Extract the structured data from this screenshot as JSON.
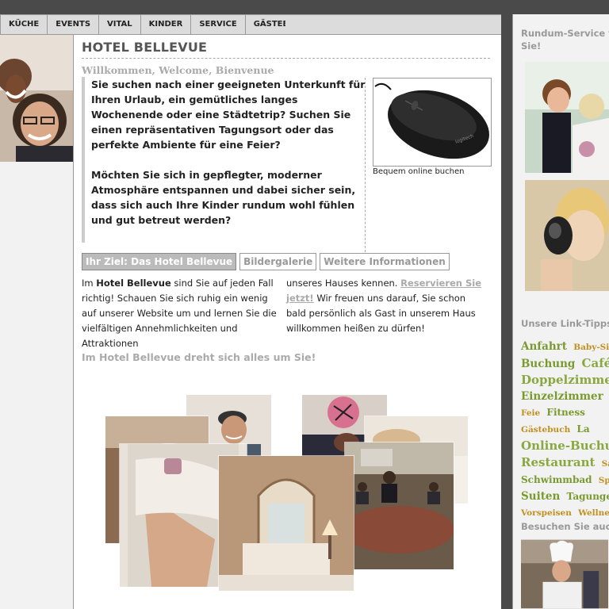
{
  "nav": {
    "items": [
      "KÜCHE",
      "EVENTS",
      "VITAL",
      "KINDER",
      "SERVICE",
      "GÄSTEBUCH"
    ]
  },
  "page": {
    "title": "HOTEL BELLEVUE",
    "subtitle": "Willkommen, Welcome, Bienvenue",
    "intro_p1": "Sie suchen nach einer geeigneten Unterkunft für Ihren Urlaub, ein gemütliches langes Wochenende oder eine Städtetrip? Suchen Sie einen repräsentativen Tagungsort oder das perfekte Ambiente für eine Feier?",
    "intro_p2": "Möchten Sie sich in gepflegter, moderner Atmosphäre entspannen und dabei sicher sein, dass sich auch Ihre Kinder rundum wohl fühlen und gut betreut werden?",
    "mouse_caption": "Bequem online buchen"
  },
  "tabs": [
    "Ihr Ziel: Das Hotel Bellevue",
    "Bildergalerie",
    "Weitere Informationen"
  ],
  "body": {
    "left_pre": "Im ",
    "left_bold": "Hotel Bellevue",
    "left_post": " sind Sie auf jeden Fall richtig! Schauen Sie sich ruhig ein wenig auf unserer Website um und lernen Sie die vielfältigen Annehmlichkeiten und Attraktionen",
    "right_pre": "unseres Hauses kennen. ",
    "right_link": "Reservieren Sie jetzt!",
    "right_post": " Wir freuen uns darauf, Sie schon bald persönlich als Gast in unserem Haus willkommen heißen zu dürfen!",
    "tagline": "Im Hotel Bellevue dreht sich alles um Sie!"
  },
  "sidebar": {
    "heading1": "Rundum-Service f",
    "heading1_line2": "Sie!",
    "heading2": "Unsere Link-Tipps",
    "heading3": "Besuchen Sie auc",
    "tags": [
      {
        "label": "Anfahrt",
        "size": "t-l"
      },
      {
        "label": "Baby-Sitte",
        "size": "t-s"
      },
      {
        "label": "Buchung",
        "size": "t-l"
      },
      {
        "label": "Café",
        "size": "t-xl"
      },
      {
        "label": "Doppelzimmer",
        "size": "t-xl"
      },
      {
        "label": "Einzelzimmer",
        "size": "t-l"
      },
      {
        "label": "Feie",
        "size": "t-s"
      },
      {
        "label": "Fitness",
        "size": "t-m"
      },
      {
        "label": "Gästebuch",
        "size": "t-s"
      },
      {
        "label": "La",
        "size": "t-m"
      },
      {
        "label": "Online-Buchung",
        "size": "t-xl"
      },
      {
        "label": "Restaurant",
        "size": "t-xl"
      },
      {
        "label": "Sau",
        "size": "t-s"
      },
      {
        "label": "Schwimmbad",
        "size": "t-m"
      },
      {
        "label": "Speis",
        "size": "t-s"
      },
      {
        "label": "Suiten",
        "size": "t-l"
      },
      {
        "label": "Tagungen",
        "size": "t-m"
      },
      {
        "label": "Vorspeisen",
        "size": "t-s"
      },
      {
        "label": "Wellness",
        "size": "t-s"
      }
    ]
  },
  "colors": {
    "accent_green": "#7a9a30",
    "accent_gold": "#c09020",
    "heading_grey": "#999999"
  }
}
